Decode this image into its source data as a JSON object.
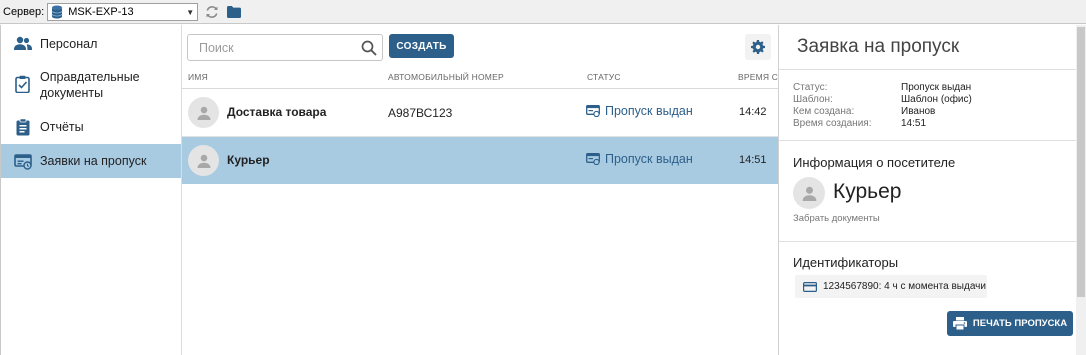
{
  "toolbar": {
    "server_label": "Сервер:",
    "server_value": "MSK-EXP-13"
  },
  "sidebar": {
    "items": [
      {
        "label_line1": "Персонал",
        "label_line2": "",
        "icon": "people-icon"
      },
      {
        "label_line1": "Оправдательные",
        "label_line2": "документы",
        "icon": "clipboard-icon"
      },
      {
        "label_line1": "Отчёты",
        "label_line2": "",
        "icon": "report-icon"
      },
      {
        "label_line1": "Заявки на пропуск",
        "label_line2": "",
        "icon": "pass-request-icon",
        "active": true
      }
    ]
  },
  "list": {
    "search_placeholder": "Поиск",
    "create_label": "СОЗДАТЬ",
    "columns": {
      "name": "ИМЯ",
      "plate": "АВТОМОБИЛЬНЫЙ НОМЕР",
      "status": "СТАТУС",
      "time": "ВРЕМЯ СОЗ"
    },
    "rows": [
      {
        "name": "Доставка товара",
        "plate": "А987ВС123",
        "status": "Пропуск выдан",
        "time": "14:42"
      },
      {
        "name": "Курьер",
        "plate": "",
        "status": "Пропуск выдан",
        "time": "14:51",
        "selected": true
      }
    ]
  },
  "details": {
    "title": "Заявка на пропуск",
    "fields": [
      {
        "key": "Статус:",
        "value": "Пропуск выдан"
      },
      {
        "key": "Шаблон:",
        "value": "Шаблон (офис)"
      },
      {
        "key": "Кем создана:",
        "value": "Иванов"
      },
      {
        "key": "Время создания:",
        "value": "14:51"
      }
    ],
    "visitor_section_title": "Информация о посетителе",
    "visitor_name": "Курьер",
    "visitor_note": "Забрать документы",
    "identifiers_title": "Идентификаторы",
    "identifier": "1234567890: 4 ч с момента выдачи",
    "print_label": "ПЕЧАТЬ ПРОПУСКА"
  },
  "colors": {
    "accent": "#2c5f8a",
    "selection": "#a9cbe2"
  }
}
